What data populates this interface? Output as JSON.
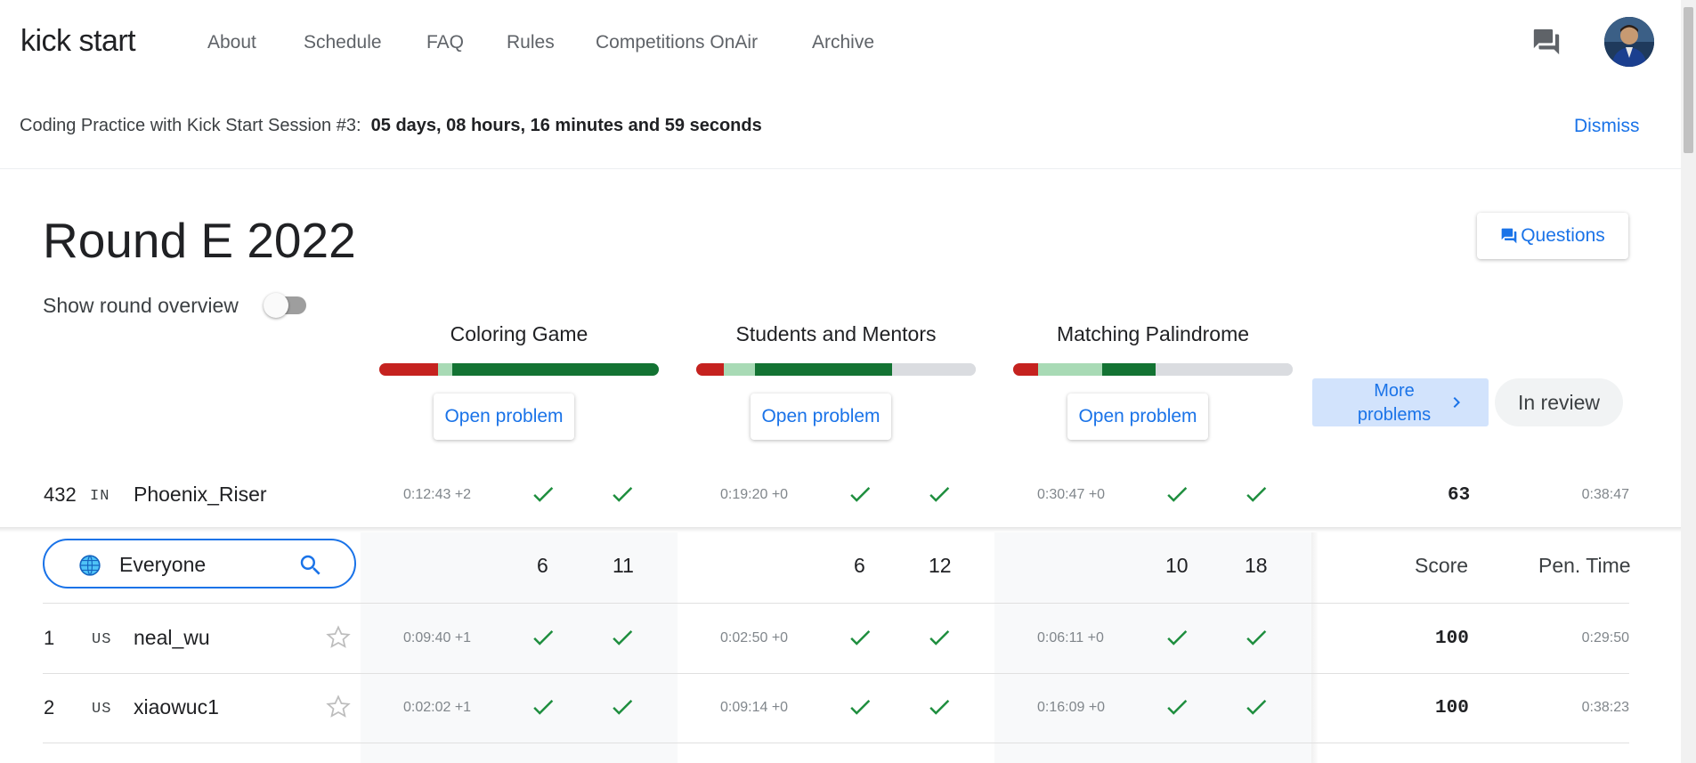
{
  "header": {
    "logo": "kick start",
    "nav": [
      "About",
      "Schedule",
      "FAQ",
      "Rules",
      "Competitions OnAir",
      "Archive"
    ]
  },
  "banner": {
    "label": "Coding Practice with Kick Start Session #3:",
    "countdown": "05 days, 08 hours, 16 minutes and 59 seconds",
    "dismiss": "Dismiss"
  },
  "round": {
    "title": "Round E 2022",
    "questions_label": "Questions",
    "overview_label": "Show round overview",
    "overview_on": false
  },
  "problems": [
    {
      "name": "Coloring Game",
      "button": "Open problem",
      "bar": {
        "red": 0.21,
        "light": 0.05,
        "green": 0.74,
        "gray": 0.0
      }
    },
    {
      "name": "Students and Mentors",
      "button": "Open problem",
      "bar": {
        "red": 0.1,
        "light": 0.11,
        "green": 0.49,
        "gray": 0.3
      }
    },
    {
      "name": "Matching Palindrome",
      "button": "Open problem",
      "bar": {
        "red": 0.09,
        "light": 0.23,
        "green": 0.19,
        "gray": 0.49
      }
    }
  ],
  "more_problems": "More problems",
  "in_review": "In review",
  "self_row": {
    "rank": "432",
    "country": "IN",
    "name": "Phoenix_Riser",
    "times": [
      "0:12:43 +2",
      "0:19:20 +0",
      "0:30:47 +0"
    ],
    "score": "63",
    "penalty": "0:38:47"
  },
  "filter": {
    "value": "Everyone"
  },
  "counts": [
    [
      "6",
      "11"
    ],
    [
      "6",
      "12"
    ],
    [
      "10",
      "18"
    ]
  ],
  "columns": {
    "score": "Score",
    "penalty": "Pen. Time"
  },
  "rows": [
    {
      "rank": "1",
      "country": "US",
      "name": "neal_wu",
      "times": [
        "0:09:40 +1",
        "0:02:50 +0",
        "0:06:11 +0"
      ],
      "score": "100",
      "penalty": "0:29:50"
    },
    {
      "rank": "2",
      "country": "US",
      "name": "xiaowuc1",
      "times": [
        "0:02:02 +1",
        "0:09:14 +0",
        "0:16:09 +0"
      ],
      "score": "100",
      "penalty": "0:38:23"
    }
  ],
  "colors": {
    "accent": "#1a73e8",
    "solved_green": "#1e8e3e",
    "bar_red": "#c5221f",
    "bar_light": "#a8dab5",
    "bar_green": "#137333",
    "bar_gray": "#dadce0"
  }
}
